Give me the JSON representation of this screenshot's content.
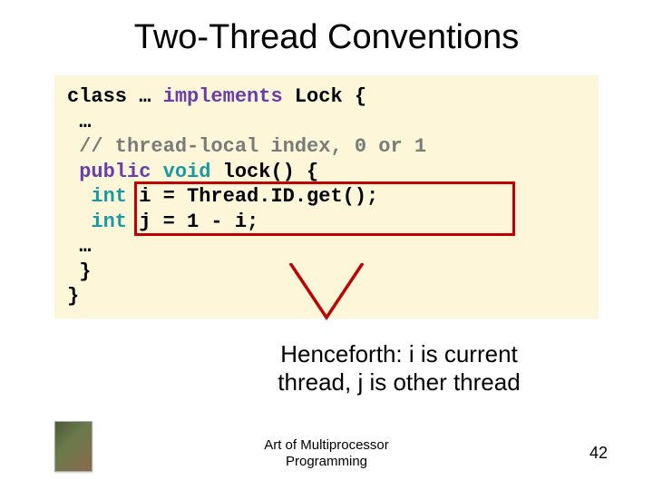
{
  "title": "Two-Thread Conventions",
  "code": {
    "l0_pre": "class … ",
    "l0_kw": "implements",
    "l0_post": " Lock {",
    "l1": " …",
    "l2": " // thread-local index, 0 or 1",
    "l3_pre": " ",
    "l3_a": "public",
    "l3_sp1": " ",
    "l3_b": "void",
    "l3_post": " lock() {",
    "l4_pre": "  ",
    "l4_a": "int",
    "l4_post": " i = Thread.ID.get();",
    "l5_pre": "  ",
    "l5_a": "int",
    "l5_post": " j = 1 - i;",
    "l6": " …",
    "l7": " }",
    "l8": "}"
  },
  "annotation_line1": "Henceforth: i is current",
  "annotation_line2": "thread, j is other thread",
  "footer": "Art of Multiprocessor\nProgramming",
  "page": "42"
}
